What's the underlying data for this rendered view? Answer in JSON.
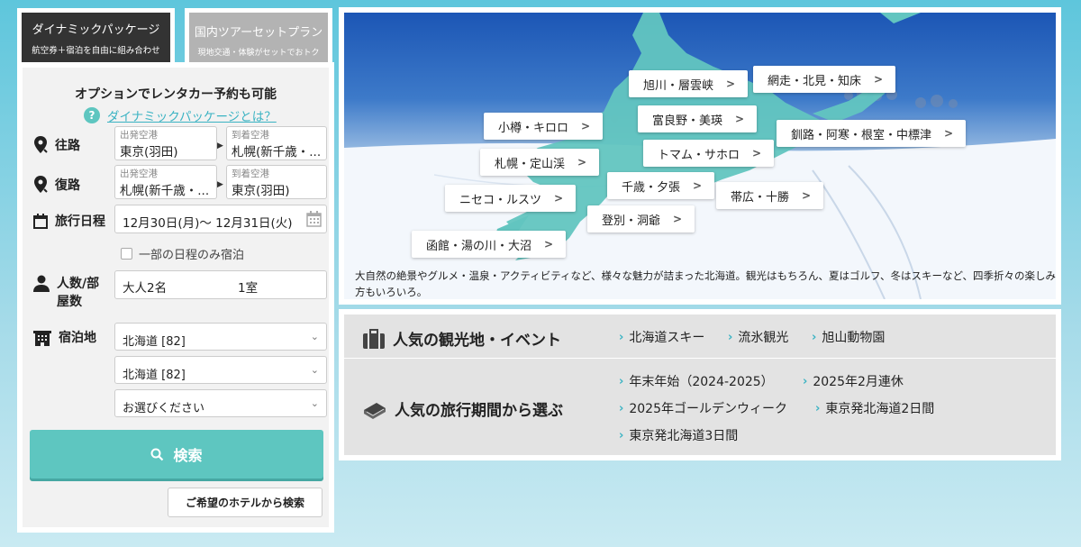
{
  "tabs": {
    "dynamic": {
      "title": "ダイナミックパッケージ",
      "sub": "航空券＋宿泊を自由に組み合わせ"
    },
    "tour": {
      "title": "国内ツアーセットプラン",
      "sub": "現地交通・体験がセットでおトク"
    }
  },
  "form": {
    "heading": "オプションでレンタカー予約も可能",
    "help_link": "ダイナミックパッケージとは？",
    "outbound": {
      "label": "往路",
      "from_caption": "出発空港",
      "from_value": "東京(羽田)",
      "to_caption": "到着空港",
      "to_value": "札幌(新千歳・..."
    },
    "return": {
      "label": "復路",
      "from_caption": "出発空港",
      "from_value": "札幌(新千歳・...",
      "to_caption": "到着空港",
      "to_value": "東京(羽田)"
    },
    "dates": {
      "label": "旅行日程",
      "value": "12月30日(月)〜  12月31日(火)"
    },
    "partial_stay": "一部の日程のみ宿泊",
    "people": {
      "label_line1": "人数/部",
      "label_line2": "屋数",
      "value": "大人2名",
      "rooms": "1室"
    },
    "lodging": {
      "label": "宿泊地",
      "select1": "北海道 [82]",
      "select2": "北海道 [82]",
      "select3": "お選びください"
    },
    "search_button": "検索",
    "hotel_button": "ご希望のホテルから検索"
  },
  "map": {
    "regions": [
      "旭川・層雲峡",
      "網走・北見・知床",
      "小樽・キロロ",
      "富良野・美瑛",
      "釧路・阿寒・根室・中標津",
      "札幌・定山渓",
      "トマム・サホロ",
      "千歳・夕張",
      "ニセコ・ルスツ",
      "帯広・十勝",
      "登別・洞爺",
      "函館・湯の川・大沼"
    ],
    "description": "大自然の絶景やグルメ・温泉・アクティビティなど、様々な魅力が詰まった北海道。観光はもちろん、夏はゴルフ、冬はスキーなど、四季折々の楽しみ方もいろいろ。"
  },
  "popular_spots": {
    "title": "人気の観光地・イベント",
    "links": [
      "北海道スキー",
      "流氷観光",
      "旭山動物園"
    ]
  },
  "popular_periods": {
    "title": "人気の旅行期間から選ぶ",
    "links": [
      "年末年始（2024-2025）",
      "2025年2月連休",
      "2025年ゴールデンウィーク",
      "東京発北海道2日間",
      "東京発北海道3日間"
    ]
  },
  "colors": {
    "accent": "#5ec6c0",
    "link": "#3bb3c3",
    "dark_tab": "#333333"
  }
}
